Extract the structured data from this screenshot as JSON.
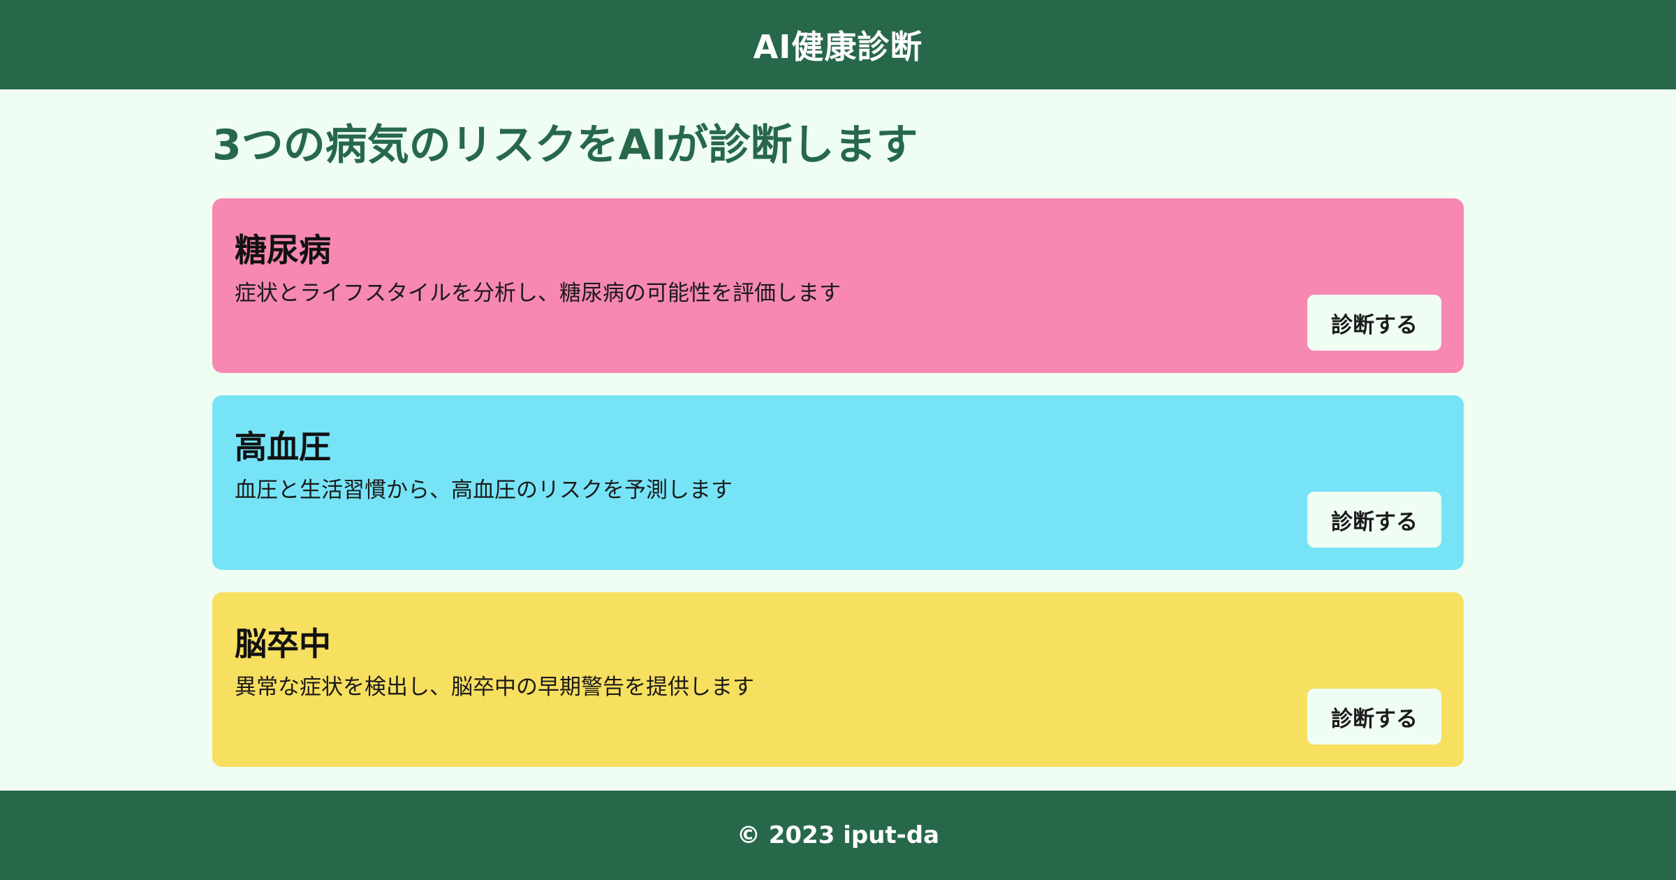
{
  "header": {
    "title": "AI健康診断"
  },
  "main": {
    "heading": "3つの病気のリスクをAIが診断します",
    "cards": [
      {
        "title": "糖尿病",
        "description": "症状とライフスタイルを分析し、糖尿病の可能性を評価します",
        "button_label": "診断する",
        "color": "#f688b2"
      },
      {
        "title": "高血圧",
        "description": "血圧と生活習慣から、高血圧のリスクを予測します",
        "button_label": "診断する",
        "color": "#76e4f6"
      },
      {
        "title": "脳卒中",
        "description": "異常な症状を検出し、脳卒中の早期警告を提供します",
        "button_label": "診断する",
        "color": "#f7df60"
      }
    ]
  },
  "footer": {
    "text": "© 2023 iput-da"
  },
  "colors": {
    "brand": "#27684b",
    "background": "#effdf3"
  }
}
